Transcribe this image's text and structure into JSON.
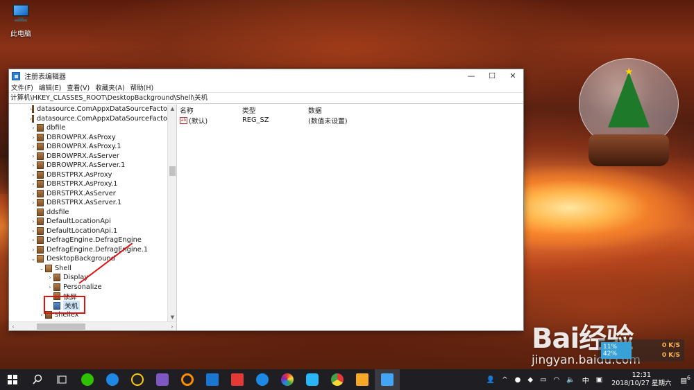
{
  "desktop": {
    "icon_label": "此电脑"
  },
  "window": {
    "title": "注册表编辑器",
    "controls": {
      "minimize": "—",
      "maximize": "☐",
      "close": "✕"
    },
    "menu": [
      "文件(F)",
      "编辑(E)",
      "查看(V)",
      "收藏夹(A)",
      "帮助(H)"
    ],
    "address": "计算机\\HKEY_CLASSES_ROOT\\DesktopBackground\\Shell\\关机"
  },
  "tree": [
    {
      "label": "datasource.ComAppxDataSourceFacto",
      "arrow": "›",
      "depth": 0
    },
    {
      "label": "datasource.ComAppxDataSourceFacto",
      "arrow": "›",
      "depth": 0
    },
    {
      "label": "dbfile",
      "arrow": "›",
      "depth": 0
    },
    {
      "label": "DBROWPRX.AsProxy",
      "arrow": "›",
      "depth": 0
    },
    {
      "label": "DBROWPRX.AsProxy.1",
      "arrow": "›",
      "depth": 0
    },
    {
      "label": "DBROWPRX.AsServer",
      "arrow": "›",
      "depth": 0
    },
    {
      "label": "DBROWPRX.AsServer.1",
      "arrow": "›",
      "depth": 0
    },
    {
      "label": "DBRSTPRX.AsProxy",
      "arrow": "›",
      "depth": 0
    },
    {
      "label": "DBRSTPRX.AsProxy.1",
      "arrow": "›",
      "depth": 0
    },
    {
      "label": "DBRSTPRX.AsServer",
      "arrow": "›",
      "depth": 0
    },
    {
      "label": "DBRSTPRX.AsServer.1",
      "arrow": "›",
      "depth": 0
    },
    {
      "label": "ddsfile",
      "arrow": "",
      "depth": 0
    },
    {
      "label": "DefaultLocationApi",
      "arrow": "›",
      "depth": 0
    },
    {
      "label": "DefaultLocationApi.1",
      "arrow": "›",
      "depth": 0
    },
    {
      "label": "DefragEngine.DefragEngine",
      "arrow": "›",
      "depth": 0
    },
    {
      "label": "DefragEngine.DefragEngine.1",
      "arrow": "›",
      "depth": 0
    },
    {
      "label": "DesktopBackground",
      "arrow": "⌄",
      "depth": 0
    },
    {
      "label": "Shell",
      "arrow": "⌄",
      "depth": 1
    },
    {
      "label": "Display",
      "arrow": "›",
      "depth": 2
    },
    {
      "label": "Personalize",
      "arrow": "›",
      "depth": 2
    },
    {
      "label": "锁屏",
      "arrow": "",
      "depth": 2
    },
    {
      "label": "关机",
      "arrow": "",
      "depth": 2,
      "selected": true
    },
    {
      "label": "shellex",
      "arrow": "›",
      "depth": 1
    }
  ],
  "values": {
    "headers": {
      "name": "名称",
      "type": "类型",
      "data": "数据"
    },
    "rows": [
      {
        "name": "(默认)",
        "type": "REG_SZ",
        "data": "(数值未设置)"
      }
    ]
  },
  "watermark": {
    "brand": "Bai经验",
    "site": "jingyan.baidu.com"
  },
  "net_speed": {
    "percent": "11%",
    "percent2": "42%",
    "up": "0 K/S",
    "down": "0 K/S"
  },
  "taskbar": {
    "ime": "中",
    "time": "12:31",
    "date": "2018/10/27 星期六",
    "notification_count": "6"
  }
}
